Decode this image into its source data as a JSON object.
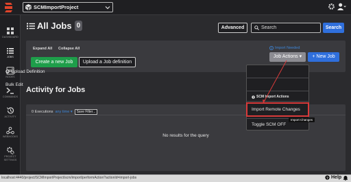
{
  "topbar": {
    "project_name": "SCMImportProject"
  },
  "sidebar": {
    "items": [
      {
        "label": "DASHBOARD",
        "icon": "dashboard-icon"
      },
      {
        "label": "JOBS",
        "icon": "jobs-list-icon",
        "active": true
      },
      {
        "label": "NODES",
        "icon": "nodes-icon"
      },
      {
        "label": "COMMANDS",
        "icon": "terminal-icon"
      },
      {
        "label": "ACTIVITY",
        "icon": "history-icon"
      },
      {
        "label": "WEBHOOKS",
        "icon": "webhooks-icon"
      },
      {
        "label": "PROJECT SETTINGS",
        "icon": "gear-icon"
      }
    ]
  },
  "header": {
    "title": "All Jobs",
    "count": "0",
    "advanced_label": "Advanced",
    "search_placeholder": "Search",
    "search_button": "Search"
  },
  "jobs_panel": {
    "expand_all": "Expand All",
    "collapse_all": "Collapse All",
    "create_button": "Create a new Job",
    "upload_button": "Upload a Job definition",
    "import_needed": "Import Needed",
    "job_actions_button": "Job Actions ▾",
    "new_job_button": "+ New Job"
  },
  "dropdown": {
    "upload_definition": "Upload Definition",
    "bulk_edit": "Bulk Edit",
    "scm_import_header": "SCM Import Actions",
    "import_remote_changes": "Import Remote Changes",
    "toggle_scm_off": "Toggle SCM OFF",
    "tooltip": "Import Changes"
  },
  "activity": {
    "title": "Activity for Jobs",
    "executions": "0 Executions",
    "any_time": "any time ▾",
    "save_filter": "Save Filter...",
    "no_results": "No results for the query"
  },
  "statusbar": {
    "url": "localhost:4440/project/SCMImportProject/scm/import/performAction?actionId=import-jobs",
    "help": "Help"
  },
  "colors": {
    "accent_blue": "#2f6fdc",
    "create_green": "#1e9e4a",
    "highlight_red": "#d93a3a"
  }
}
